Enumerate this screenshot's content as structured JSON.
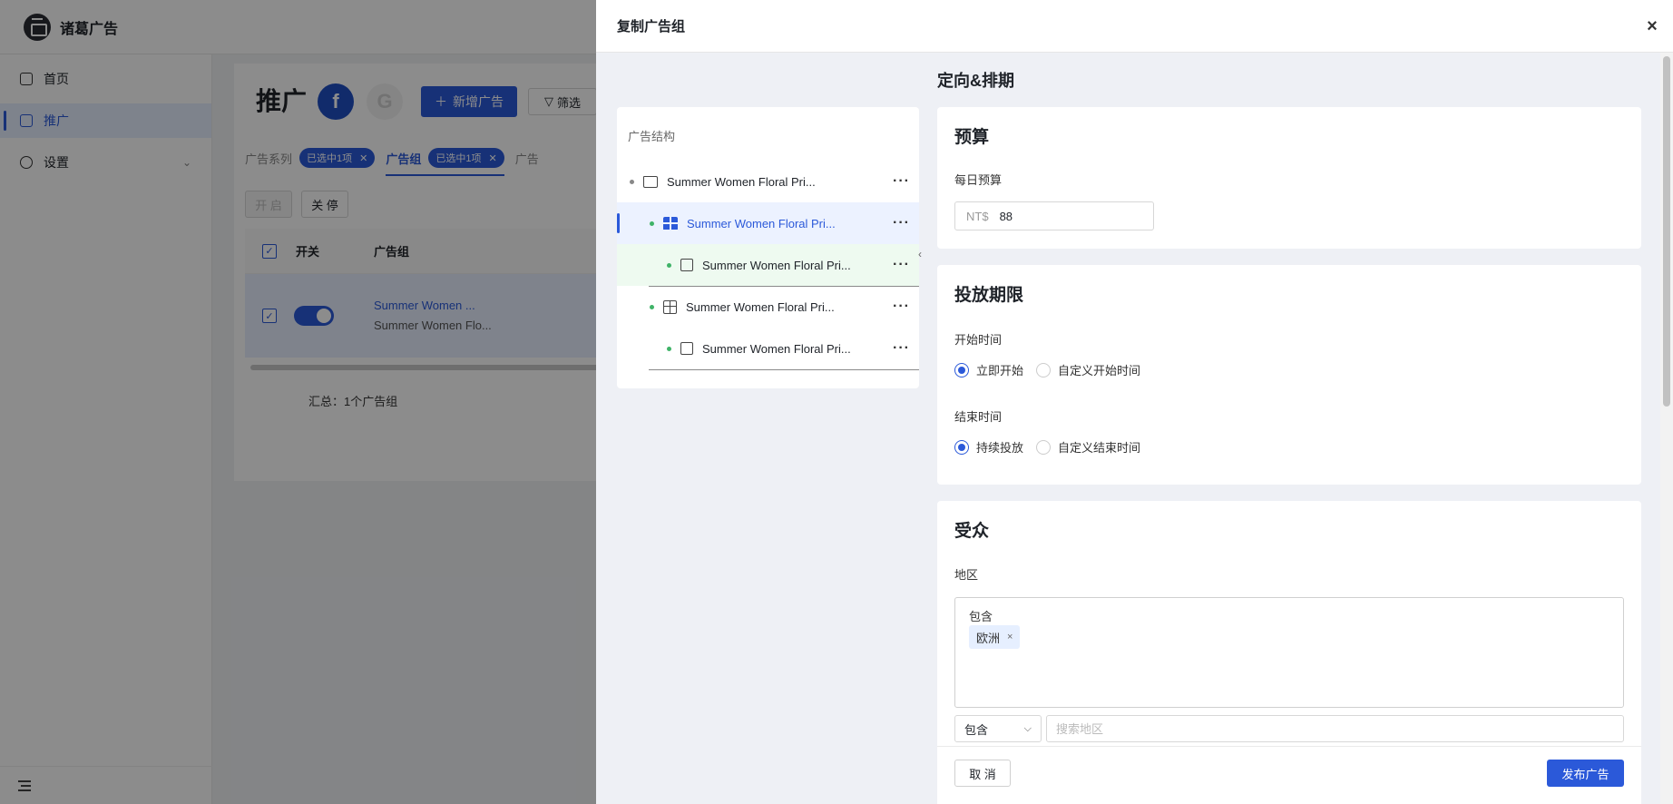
{
  "app": {
    "brand": "诸葛广告"
  },
  "sidebar": {
    "items": [
      {
        "label": "首页"
      },
      {
        "label": "推广"
      },
      {
        "label": "设置"
      }
    ]
  },
  "page": {
    "title": "推广",
    "fb_letter": "f",
    "google_letter": "G",
    "new_ad_label": "新增广告",
    "filter_label": "筛选",
    "tabs": [
      {
        "label": "广告系列",
        "chip": "已选中1项"
      },
      {
        "label": "广告组",
        "chip": "已选中1项"
      },
      {
        "label": "广告"
      }
    ],
    "enable_label": "开 启",
    "pause_label": "关 停",
    "table": {
      "headers": [
        "开关",
        "广告组"
      ],
      "row": {
        "name": "Summer Women ...",
        "sub": "Summer Women Flo..."
      }
    },
    "summary": "汇总：1个广告组"
  },
  "drawer": {
    "title": "复制广告组",
    "tree": {
      "title": "广告结构",
      "nodes": [
        {
          "label": "Summer Women Floral Pri..."
        },
        {
          "label": "Summer Women Floral Pri..."
        },
        {
          "label": "Summer Women Floral Pri..."
        },
        {
          "label": "Summer Women Floral Pri..."
        },
        {
          "label": "Summer Women Floral Pri..."
        }
      ]
    },
    "section_title": "定向&排期",
    "budget": {
      "title": "预算",
      "daily_label": "每日预算",
      "currency": "NT$",
      "value": "88"
    },
    "schedule": {
      "title": "投放期限",
      "start_label": "开始时间",
      "start_options": [
        "立即开始",
        "自定义开始时间"
      ],
      "end_label": "结束时间",
      "end_options": [
        "持续投放",
        "自定义结束时间"
      ]
    },
    "audience": {
      "title": "受众",
      "region_label": "地区",
      "include_label": "包含",
      "tags": [
        "欧洲"
      ],
      "select_value": "包含",
      "search_placeholder": "搜索地区"
    },
    "cancel_label": "取 消",
    "publish_label": "发布广告"
  },
  "colors": {
    "primary": "#2b59d9",
    "overlay": "rgba(0,0,0,0.45)",
    "green_dot": "#3fb368"
  }
}
